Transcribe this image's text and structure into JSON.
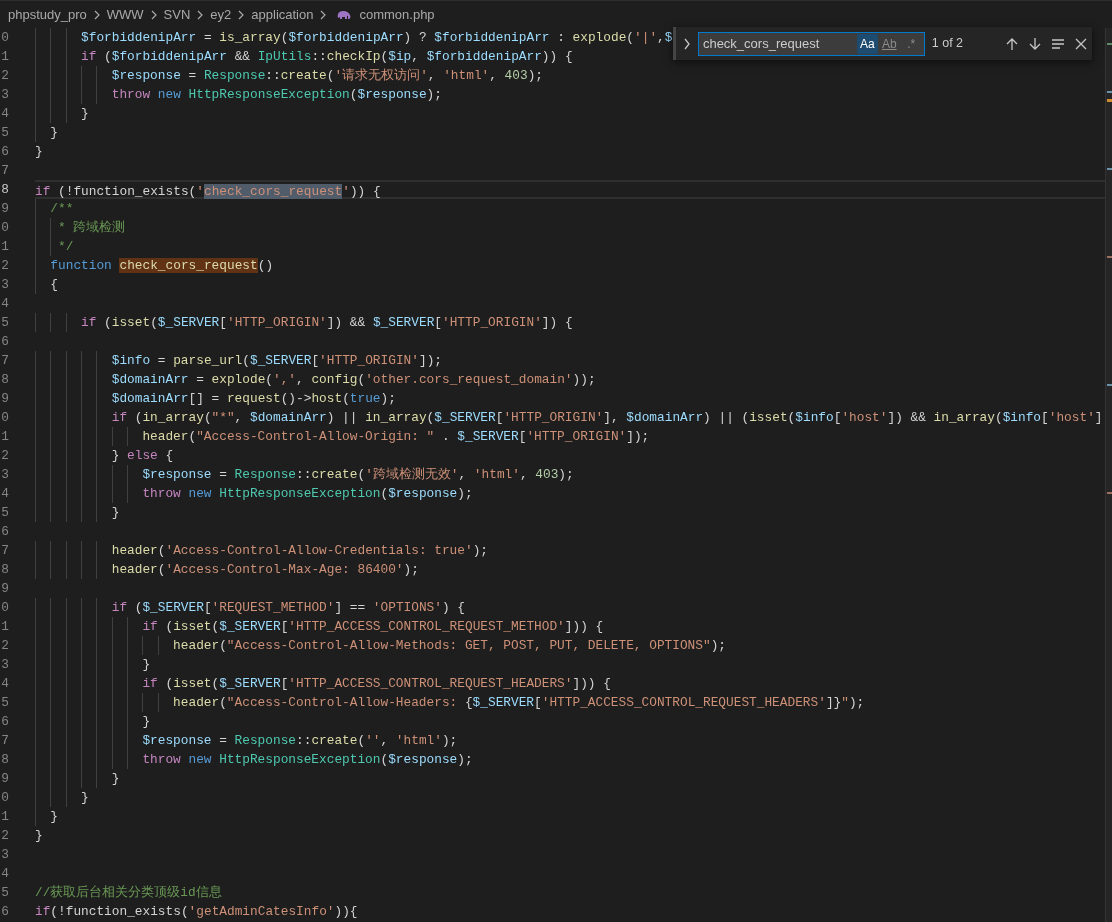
{
  "breadcrumb": [
    {
      "label": "phpstudy_pro",
      "kind": "folder"
    },
    {
      "label": "WWW",
      "kind": "folder"
    },
    {
      "label": "SVN",
      "kind": "folder"
    },
    {
      "label": "ey2",
      "kind": "folder"
    },
    {
      "label": "application",
      "kind": "folder"
    },
    {
      "label": "common.php",
      "kind": "php"
    }
  ],
  "lines": [
    {
      "number": "0",
      "current": false,
      "tokens": [
        {
          "kind": "var",
          "text": "      $forbiddenipArr"
        },
        {
          "kind": "punc",
          "text": " = "
        },
        {
          "kind": "fn",
          "text": "is_array"
        },
        {
          "kind": "punc",
          "text": "("
        },
        {
          "kind": "var",
          "text": "$forbiddenipArr"
        },
        {
          "kind": "punc",
          "text": ") ? "
        },
        {
          "kind": "var",
          "text": "$forbiddenipArr"
        },
        {
          "kind": "punc",
          "text": " : "
        },
        {
          "kind": "fn",
          "text": "explode"
        },
        {
          "kind": "punc",
          "text": "("
        },
        {
          "kind": "str",
          "text": "'|'"
        },
        {
          "kind": "punc",
          "text": ","
        },
        {
          "kind": "var",
          "text": "$"
        }
      ]
    },
    {
      "number": "1",
      "current": false,
      "tokens": [
        {
          "kind": "ctl",
          "text": "      if"
        },
        {
          "kind": "punc",
          "text": " ("
        },
        {
          "kind": "var",
          "text": "$forbiddenipArr"
        },
        {
          "kind": "punc",
          "text": " && "
        },
        {
          "kind": "type",
          "text": "IpUtils"
        },
        {
          "kind": "punc",
          "text": "::"
        },
        {
          "kind": "fn",
          "text": "checkIp"
        },
        {
          "kind": "punc",
          "text": "("
        },
        {
          "kind": "var",
          "text": "$ip"
        },
        {
          "kind": "punc",
          "text": ", "
        },
        {
          "kind": "var",
          "text": "$forbiddenipArr"
        },
        {
          "kind": "punc",
          "text": ")) {"
        }
      ]
    },
    {
      "number": "2",
      "current": false,
      "tokens": [
        {
          "kind": "var",
          "text": "          $response"
        },
        {
          "kind": "punc",
          "text": " = "
        },
        {
          "kind": "type",
          "text": "Response"
        },
        {
          "kind": "punc",
          "text": "::"
        },
        {
          "kind": "fn",
          "text": "create"
        },
        {
          "kind": "punc",
          "text": "("
        },
        {
          "kind": "str",
          "text": "'请求无权访问'"
        },
        {
          "kind": "punc",
          "text": ", "
        },
        {
          "kind": "str",
          "text": "'html'"
        },
        {
          "kind": "punc",
          "text": ", "
        },
        {
          "kind": "num",
          "text": "403"
        },
        {
          "kind": "punc",
          "text": ");"
        }
      ]
    },
    {
      "number": "3",
      "current": false,
      "tokens": [
        {
          "kind": "ctl",
          "text": "          throw"
        },
        {
          "kind": "kw",
          "text": " new"
        },
        {
          "kind": "type",
          "text": " HttpResponseException"
        },
        {
          "kind": "punc",
          "text": "("
        },
        {
          "kind": "var",
          "text": "$response"
        },
        {
          "kind": "punc",
          "text": ");"
        }
      ]
    },
    {
      "number": "4",
      "current": false,
      "tokens": [
        {
          "kind": "punc",
          "text": "      }"
        }
      ]
    },
    {
      "number": "5",
      "current": false,
      "tokens": [
        {
          "kind": "punc",
          "text": "  }"
        }
      ]
    },
    {
      "number": "6",
      "current": false,
      "tokens": [
        {
          "kind": "punc",
          "text": "}"
        }
      ]
    },
    {
      "number": "7",
      "current": false
    },
    {
      "number": "8",
      "current": true,
      "tokens": [
        {
          "kind": "ctl",
          "text": "if"
        },
        {
          "kind": "punc",
          "text": " (!function_exists("
        },
        {
          "kind": "str",
          "text": "'"
        },
        {
          "kind": "str",
          "text": "check_cors_request",
          "found": true,
          "current": true
        },
        {
          "kind": "str",
          "text": "'"
        },
        {
          "kind": "punc",
          "text": ")) {"
        }
      ]
    },
    {
      "number": "9",
      "current": false,
      "tokens": [
        {
          "kind": "cmt",
          "text": "  /**"
        }
      ]
    },
    {
      "number": "0",
      "current": false,
      "tokens": [
        {
          "kind": "cmt",
          "text": "   * 跨域检测"
        }
      ]
    },
    {
      "number": "1",
      "current": false,
      "tokens": [
        {
          "kind": "cmt",
          "text": "   */"
        }
      ]
    },
    {
      "number": "2",
      "current": false,
      "tokens": [
        {
          "kind": "kw",
          "text": "  function "
        },
        {
          "kind": "fn",
          "text": "check_cors_request",
          "found": true,
          "current": false
        },
        {
          "kind": "punc",
          "text": "()"
        }
      ]
    },
    {
      "number": "3",
      "current": false,
      "tokens": [
        {
          "kind": "punc",
          "text": "  {"
        }
      ]
    },
    {
      "number": "4",
      "current": false
    },
    {
      "number": "5",
      "current": false,
      "tokens": [
        {
          "kind": "ctl",
          "text": "      if"
        },
        {
          "kind": "punc",
          "text": " ("
        },
        {
          "kind": "fn",
          "text": "isset"
        },
        {
          "kind": "punc",
          "text": "("
        },
        {
          "kind": "var",
          "text": "$_SERVER"
        },
        {
          "kind": "punc",
          "text": "["
        },
        {
          "kind": "str",
          "text": "'HTTP_ORIGIN'"
        },
        {
          "kind": "punc",
          "text": "]) && "
        },
        {
          "kind": "var",
          "text": "$_SERVER"
        },
        {
          "kind": "punc",
          "text": "["
        },
        {
          "kind": "str",
          "text": "'HTTP_ORIGIN'"
        },
        {
          "kind": "punc",
          "text": "]) {"
        }
      ]
    },
    {
      "number": "6",
      "current": false
    },
    {
      "number": "7",
      "current": false,
      "tokens": [
        {
          "kind": "var",
          "text": "          $info"
        },
        {
          "kind": "punc",
          "text": " = "
        },
        {
          "kind": "fn",
          "text": "parse_url"
        },
        {
          "kind": "punc",
          "text": "("
        },
        {
          "kind": "var",
          "text": "$_SERVER"
        },
        {
          "kind": "punc",
          "text": "["
        },
        {
          "kind": "str",
          "text": "'HTTP_ORIGIN'"
        },
        {
          "kind": "punc",
          "text": "]);"
        }
      ]
    },
    {
      "number": "8",
      "current": false,
      "tokens": [
        {
          "kind": "var",
          "text": "          $domainArr"
        },
        {
          "kind": "punc",
          "text": " = "
        },
        {
          "kind": "fn",
          "text": "explode"
        },
        {
          "kind": "punc",
          "text": "("
        },
        {
          "kind": "str",
          "text": "','"
        },
        {
          "kind": "punc",
          "text": ", "
        },
        {
          "kind": "fn",
          "text": "config"
        },
        {
          "kind": "punc",
          "text": "("
        },
        {
          "kind": "str",
          "text": "'other.cors_request_domain'"
        },
        {
          "kind": "punc",
          "text": "));"
        }
      ]
    },
    {
      "number": "9",
      "current": false,
      "tokens": [
        {
          "kind": "var",
          "text": "          $domainArr"
        },
        {
          "kind": "punc",
          "text": "[] = "
        },
        {
          "kind": "fn",
          "text": "request"
        },
        {
          "kind": "punc",
          "text": "()->"
        },
        {
          "kind": "fn",
          "text": "host"
        },
        {
          "kind": "punc",
          "text": "("
        },
        {
          "kind": "kw",
          "text": "true"
        },
        {
          "kind": "punc",
          "text": ");"
        }
      ]
    },
    {
      "number": "0",
      "current": false,
      "tokens": [
        {
          "kind": "ctl",
          "text": "          if"
        },
        {
          "kind": "punc",
          "text": " ("
        },
        {
          "kind": "fn",
          "text": "in_array"
        },
        {
          "kind": "punc",
          "text": "("
        },
        {
          "kind": "str",
          "text": "\"*\""
        },
        {
          "kind": "punc",
          "text": ", "
        },
        {
          "kind": "var",
          "text": "$domainArr"
        },
        {
          "kind": "punc",
          "text": ") || "
        },
        {
          "kind": "fn",
          "text": "in_array"
        },
        {
          "kind": "punc",
          "text": "("
        },
        {
          "kind": "var",
          "text": "$_SERVER"
        },
        {
          "kind": "punc",
          "text": "["
        },
        {
          "kind": "str",
          "text": "'HTTP_ORIGIN'"
        },
        {
          "kind": "punc",
          "text": "], "
        },
        {
          "kind": "var",
          "text": "$domainArr"
        },
        {
          "kind": "punc",
          "text": ") || ("
        },
        {
          "kind": "fn",
          "text": "isset"
        },
        {
          "kind": "punc",
          "text": "("
        },
        {
          "kind": "var",
          "text": "$info"
        },
        {
          "kind": "punc",
          "text": "["
        },
        {
          "kind": "str",
          "text": "'host'"
        },
        {
          "kind": "punc",
          "text": "]) && "
        },
        {
          "kind": "fn",
          "text": "in_array"
        },
        {
          "kind": "punc",
          "text": "("
        },
        {
          "kind": "var",
          "text": "$info"
        },
        {
          "kind": "punc",
          "text": "["
        },
        {
          "kind": "str",
          "text": "'host'"
        },
        {
          "kind": "punc",
          "text": "]"
        }
      ]
    },
    {
      "number": "1",
      "current": false,
      "tokens": [
        {
          "kind": "fn",
          "text": "              header"
        },
        {
          "kind": "punc",
          "text": "("
        },
        {
          "kind": "str",
          "text": "\"Access-Control-Allow-Origin: \""
        },
        {
          "kind": "punc",
          "text": " . "
        },
        {
          "kind": "var",
          "text": "$_SERVER"
        },
        {
          "kind": "punc",
          "text": "["
        },
        {
          "kind": "str",
          "text": "'HTTP_ORIGIN'"
        },
        {
          "kind": "punc",
          "text": "]);"
        }
      ]
    },
    {
      "number": "2",
      "current": false,
      "tokens": [
        {
          "kind": "punc",
          "text": "          }"
        },
        {
          "kind": "ctl",
          "text": " else"
        },
        {
          "kind": "punc",
          "text": " {"
        }
      ]
    },
    {
      "number": "3",
      "current": false,
      "tokens": [
        {
          "kind": "var",
          "text": "              $response"
        },
        {
          "kind": "punc",
          "text": " = "
        },
        {
          "kind": "type",
          "text": "Response"
        },
        {
          "kind": "punc",
          "text": "::"
        },
        {
          "kind": "fn",
          "text": "create"
        },
        {
          "kind": "punc",
          "text": "("
        },
        {
          "kind": "str",
          "text": "'跨域检测无效'"
        },
        {
          "kind": "punc",
          "text": ", "
        },
        {
          "kind": "str",
          "text": "'html'"
        },
        {
          "kind": "punc",
          "text": ", "
        },
        {
          "kind": "num",
          "text": "403"
        },
        {
          "kind": "punc",
          "text": ");"
        }
      ]
    },
    {
      "number": "4",
      "current": false,
      "tokens": [
        {
          "kind": "ctl",
          "text": "              throw"
        },
        {
          "kind": "kw",
          "text": " new"
        },
        {
          "kind": "type",
          "text": " HttpResponseException"
        },
        {
          "kind": "punc",
          "text": "("
        },
        {
          "kind": "var",
          "text": "$response"
        },
        {
          "kind": "punc",
          "text": ");"
        }
      ]
    },
    {
      "number": "5",
      "current": false,
      "tokens": [
        {
          "kind": "punc",
          "text": "          }"
        }
      ]
    },
    {
      "number": "6",
      "current": false
    },
    {
      "number": "7",
      "current": false,
      "tokens": [
        {
          "kind": "fn",
          "text": "          header"
        },
        {
          "kind": "punc",
          "text": "("
        },
        {
          "kind": "str",
          "text": "'Access-Control-Allow-Credentials: true'"
        },
        {
          "kind": "punc",
          "text": ");"
        }
      ]
    },
    {
      "number": "8",
      "current": false,
      "tokens": [
        {
          "kind": "fn",
          "text": "          header"
        },
        {
          "kind": "punc",
          "text": "("
        },
        {
          "kind": "str",
          "text": "'Access-Control-Max-Age: 86400'"
        },
        {
          "kind": "punc",
          "text": ");"
        }
      ]
    },
    {
      "number": "9",
      "current": false
    },
    {
      "number": "0",
      "current": false,
      "tokens": [
        {
          "kind": "ctl",
          "text": "          if"
        },
        {
          "kind": "punc",
          "text": " ("
        },
        {
          "kind": "var",
          "text": "$_SERVER"
        },
        {
          "kind": "punc",
          "text": "["
        },
        {
          "kind": "str",
          "text": "'REQUEST_METHOD'"
        },
        {
          "kind": "punc",
          "text": "] == "
        },
        {
          "kind": "str",
          "text": "'OPTIONS'"
        },
        {
          "kind": "punc",
          "text": ") {"
        }
      ]
    },
    {
      "number": "1",
      "current": false,
      "tokens": [
        {
          "kind": "ctl",
          "text": "              if"
        },
        {
          "kind": "punc",
          "text": " ("
        },
        {
          "kind": "fn",
          "text": "isset"
        },
        {
          "kind": "punc",
          "text": "("
        },
        {
          "kind": "var",
          "text": "$_SERVER"
        },
        {
          "kind": "punc",
          "text": "["
        },
        {
          "kind": "str",
          "text": "'HTTP_ACCESS_CONTROL_REQUEST_METHOD'"
        },
        {
          "kind": "punc",
          "text": "])) {"
        }
      ]
    },
    {
      "number": "2",
      "current": false,
      "tokens": [
        {
          "kind": "fn",
          "text": "                  header"
        },
        {
          "kind": "punc",
          "text": "("
        },
        {
          "kind": "str",
          "text": "\"Access-Control-Allow-Methods: GET, POST, PUT, DELETE, OPTIONS\""
        },
        {
          "kind": "punc",
          "text": ");"
        }
      ]
    },
    {
      "number": "3",
      "current": false,
      "tokens": [
        {
          "kind": "punc",
          "text": "              }"
        }
      ]
    },
    {
      "number": "4",
      "current": false,
      "tokens": [
        {
          "kind": "ctl",
          "text": "              if"
        },
        {
          "kind": "punc",
          "text": " ("
        },
        {
          "kind": "fn",
          "text": "isset"
        },
        {
          "kind": "punc",
          "text": "("
        },
        {
          "kind": "var",
          "text": "$_SERVER"
        },
        {
          "kind": "punc",
          "text": "["
        },
        {
          "kind": "str",
          "text": "'HTTP_ACCESS_CONTROL_REQUEST_HEADERS'"
        },
        {
          "kind": "punc",
          "text": "])) {"
        }
      ]
    },
    {
      "number": "5",
      "current": false,
      "tokens": [
        {
          "kind": "fn",
          "text": "                  header"
        },
        {
          "kind": "punc",
          "text": "("
        },
        {
          "kind": "str",
          "text": "\"Access-Control-Allow-Headers: "
        },
        {
          "kind": "punc",
          "text": "{"
        },
        {
          "kind": "var",
          "text": "$_SERVER"
        },
        {
          "kind": "punc",
          "text": "["
        },
        {
          "kind": "str",
          "text": "'HTTP_ACCESS_CONTROL_REQUEST_HEADERS'"
        },
        {
          "kind": "punc",
          "text": "]}"
        },
        {
          "kind": "str",
          "text": "\""
        },
        {
          "kind": "punc",
          "text": ");"
        }
      ]
    },
    {
      "number": "6",
      "current": false,
      "tokens": [
        {
          "kind": "punc",
          "text": "              }"
        }
      ]
    },
    {
      "number": "7",
      "current": false,
      "tokens": [
        {
          "kind": "var",
          "text": "              $response"
        },
        {
          "kind": "punc",
          "text": " = "
        },
        {
          "kind": "type",
          "text": "Response"
        },
        {
          "kind": "punc",
          "text": "::"
        },
        {
          "kind": "fn",
          "text": "create"
        },
        {
          "kind": "punc",
          "text": "("
        },
        {
          "kind": "str",
          "text": "''"
        },
        {
          "kind": "punc",
          "text": ", "
        },
        {
          "kind": "str",
          "text": "'html'"
        },
        {
          "kind": "punc",
          "text": ");"
        }
      ]
    },
    {
      "number": "8",
      "current": false,
      "tokens": [
        {
          "kind": "ctl",
          "text": "              throw"
        },
        {
          "kind": "kw",
          "text": " new"
        },
        {
          "kind": "type",
          "text": " HttpResponseException"
        },
        {
          "kind": "punc",
          "text": "("
        },
        {
          "kind": "var",
          "text": "$response"
        },
        {
          "kind": "punc",
          "text": ");"
        }
      ]
    },
    {
      "number": "9",
      "current": false,
      "tokens": [
        {
          "kind": "punc",
          "text": "          }"
        }
      ]
    },
    {
      "number": "0",
      "current": false,
      "tokens": [
        {
          "kind": "punc",
          "text": "      }"
        }
      ]
    },
    {
      "number": "1",
      "current": false,
      "tokens": [
        {
          "kind": "punc",
          "text": "  }"
        }
      ]
    },
    {
      "number": "2",
      "current": false,
      "tokens": [
        {
          "kind": "punc",
          "text": "}"
        }
      ]
    },
    {
      "number": "3",
      "current": false
    },
    {
      "number": "4",
      "current": false
    },
    {
      "number": "5",
      "current": false,
      "tokens": [
        {
          "kind": "cmt",
          "text": "//获取后台相关分类顶级id信息"
        }
      ]
    },
    {
      "number": "6",
      "current": false,
      "tokens": [
        {
          "kind": "ctl",
          "text": "if"
        },
        {
          "kind": "punc",
          "text": "(!function_exists("
        },
        {
          "kind": "str",
          "text": "'getAdminCatesInfo'"
        },
        {
          "kind": "punc",
          "text": ")){"
        }
      ]
    }
  ],
  "find_widget": {
    "replace_expanded": false,
    "value": "check_cors_request",
    "options": [
      {
        "kind": "case",
        "label": "Aa",
        "on": true
      },
      {
        "kind": "word",
        "label": "Ab",
        "on": false
      },
      {
        "kind": "regex",
        "label": ".*",
        "on": false
      }
    ],
    "count": "1 of 2"
  }
}
